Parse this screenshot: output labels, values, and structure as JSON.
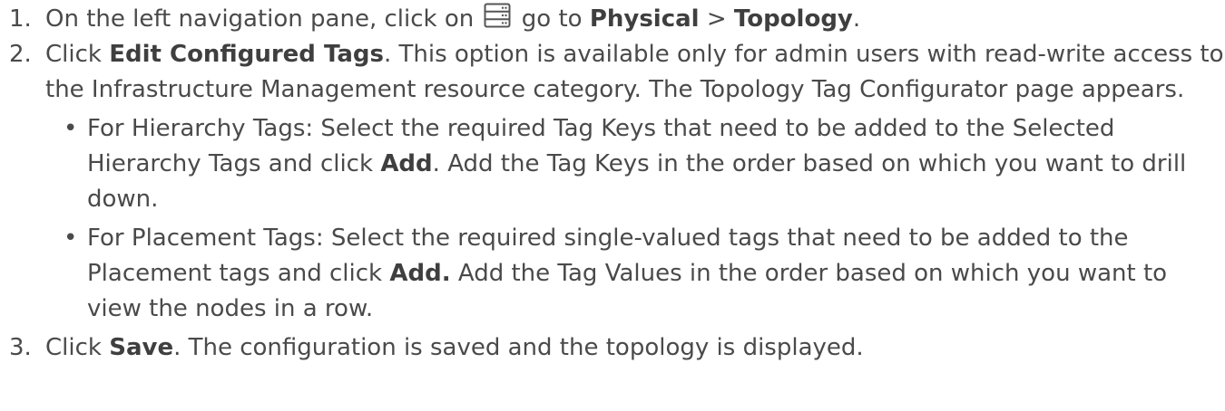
{
  "steps": [
    {
      "number": "1.",
      "pre": "On the left navigation pane, click on",
      "icon": "server-stack-icon",
      "mid": "go to",
      "bold1": "Physical",
      "sep": ">",
      "bold2": "Topology",
      "end": "."
    },
    {
      "number": "2.",
      "pre": "Click",
      "bold": "Edit Configured Tags",
      "post": ". This option is available only for admin users with read-write access to the Infrastructure Management resource category. The Topology Tag Configurator page appears.",
      "sub_items": [
        {
          "bullet": "•",
          "pre": "For Hierarchy Tags: Select the required Tag Keys that need to be added to the Selected Hierarchy Tags and click",
          "bold": "Add",
          "post": ". Add the Tag Keys in the order based on which you want to drill down."
        },
        {
          "bullet": "•",
          "pre": "For Placement Tags: Select the required single-valued tags that need to be added to the Placement tags and click",
          "bold": "Add.",
          "post": "Add the Tag Values in the order based on which you want to view the nodes in a row."
        }
      ]
    },
    {
      "number": "3.",
      "pre": "Click",
      "bold": "Save",
      "post": ". The configuration is saved and the topology is displayed."
    }
  ],
  "colors": {
    "text": "#4a4a4a",
    "icon_stroke": "#555555"
  }
}
